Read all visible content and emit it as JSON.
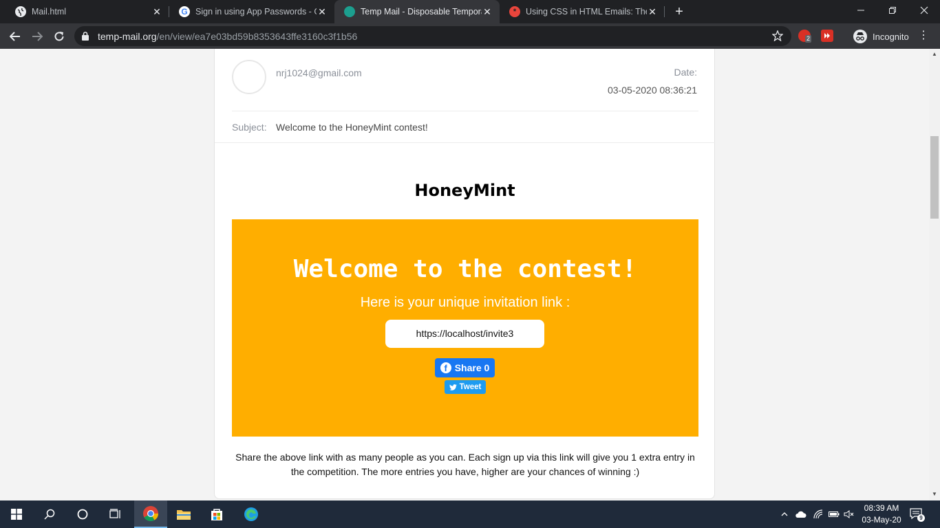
{
  "browser": {
    "tabs": [
      {
        "title": "Mail.html",
        "active": false
      },
      {
        "title": "Sign in using App Passwords - Go",
        "active": false
      },
      {
        "title": "Temp Mail - Disposable Tempora",
        "active": true
      },
      {
        "title": "Using CSS in HTML Emails: The R",
        "active": false
      }
    ],
    "url_host": "temp-mail.org",
    "url_path": "/en/view/ea7e03bd59b8353643ffe3160c3f1b56",
    "profile_label": "Incognito",
    "extension_badge": "2"
  },
  "email": {
    "from": "nrj1024@gmail.com",
    "date_label": "Date:",
    "date_value": "03-05-2020 08:36:21",
    "subject_label": "Subject:",
    "subject_value": "Welcome to the HoneyMint contest!",
    "body": {
      "brand": "HoneyMint",
      "banner_title": "Welcome to the contest!",
      "banner_subtitle": "Here is your unique invitation link :",
      "invite_link": "https://localhost/invite3",
      "share_label": "Share 0",
      "tweet_label": "Tweet",
      "paragraph": "Share the above link with as many people as you can. Each sign up via this link will give you 1 extra entry in the competition. The more entries you have, higher are your chances of winning :)"
    },
    "banner_color": "#ffae00"
  },
  "taskbar": {
    "time": "08:39 AM",
    "date": "03-May-20",
    "notification_count": "9"
  }
}
